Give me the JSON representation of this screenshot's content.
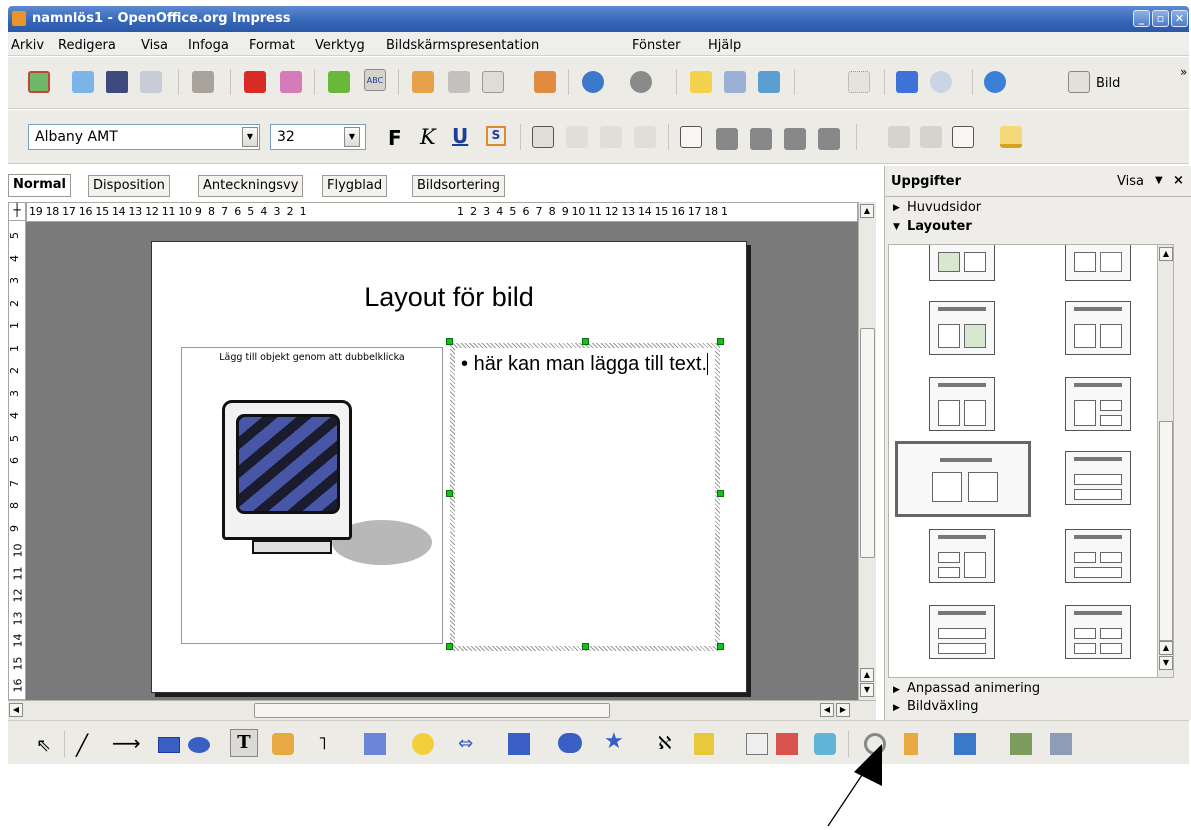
{
  "window": {
    "title": "namnlös1 - OpenOffice.org Impress"
  },
  "menu": [
    "Arkiv",
    "Redigera",
    "Visa",
    "Infoga",
    "Format",
    "Verktyg",
    "Bildskärmspresentation",
    "Fönster",
    "Hjälp"
  ],
  "toolbar": {
    "new_slide_label": "Bild",
    "overflow": "»"
  },
  "format": {
    "font_name": "Albany AMT",
    "font_size": "32",
    "bold": "F",
    "italic": "K",
    "underline": "U",
    "shadow": "S"
  },
  "view_tabs": [
    "Normal",
    "Disposition",
    "Anteckningsvy",
    "Flygblad",
    "Bildsortering"
  ],
  "ruler": {
    "horizontal": "19 18 17 16 15 14 13 12 11 10 9  8  7  6  5  4  3  2  1",
    "horizontal_right": "1  2  3  4  5  6  7  8  9 10 11 12 13 14 15 16 17 18 1",
    "vertical": [
      "5",
      "4",
      "3",
      "2",
      "1",
      "1",
      "2",
      "3",
      "4",
      "5",
      "6",
      "7",
      "8",
      "9",
      "10",
      "11",
      "12",
      "13",
      "14",
      "15",
      "16"
    ]
  },
  "slide": {
    "title": "Layout för bild",
    "object_placeholder": "Lägg till objekt genom att dubbelklicka",
    "text": "här kan man lägga till text."
  },
  "taskpane": {
    "title": "Uppgifter",
    "view_menu": "Visa",
    "sections": {
      "master": "Huvudsidor",
      "layouts": "Layouter",
      "animation": "Anpassad animering",
      "transition": "Bildväxling"
    }
  },
  "colors": {
    "titlebar": "#3565b8",
    "handle": "#12c21a",
    "workarea": "#7a7a7a"
  }
}
